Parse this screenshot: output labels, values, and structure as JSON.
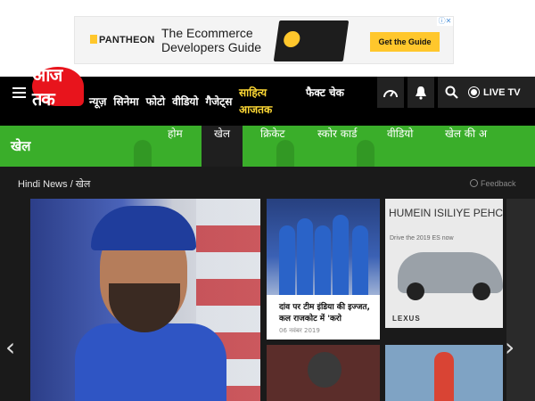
{
  "ad": {
    "brand": "PANTHEON",
    "headline": "The Ecommerce Developers Guide",
    "cta": "Get the Guide",
    "close": "ⓘ✕"
  },
  "header": {
    "logo": "आज तक",
    "nav": [
      "न्यूज़",
      "सिनेमा",
      "फोटो",
      "वीडियो",
      "गैजेट्स"
    ],
    "sahitya": "साहित्य आजतक",
    "factcheck": "फैक्ट चेक",
    "live": "LIVE TV",
    "icons": [
      "speedometer-icon",
      "bell-icon",
      "search-icon"
    ]
  },
  "section": {
    "title": "खेल",
    "tabs": [
      "होम",
      "खेल",
      "क्रिकेट",
      "स्कोर कार्ड",
      "वीडियो",
      "खेल की अ"
    ],
    "active_tab": 1,
    "accent": "#3aae2a"
  },
  "breadcrumb": {
    "home": "Hindi News",
    "sep": "/",
    "current": "खेल",
    "feedback": "Feedback"
  },
  "cards": {
    "story1_title": "दांव पर टीम इंडिया की इज्जत, कल राजकोट में 'करो",
    "story1_date": "06 नवंबर 2019",
    "ad2_headline": "HUMEIN ISILIYE PEHCHANTI HAI DUN",
    "ad2_sub": "Drive the 2019 ES now",
    "ad2_brand": "LEXUS"
  },
  "arrows": {
    "left": "‹",
    "right": "›"
  }
}
